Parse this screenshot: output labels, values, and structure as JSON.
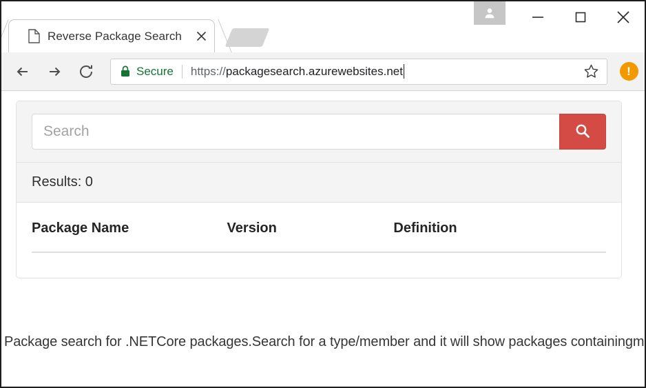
{
  "window": {
    "profile_icon": "person-icon",
    "minimize_label": "–",
    "maximize_label": "□",
    "close_label": "✕"
  },
  "tab": {
    "favicon": "document-icon",
    "title": "Reverse Package Search",
    "close_label": "✕",
    "newtab_name": "new-tab-button"
  },
  "toolbar": {
    "back_icon": "back-arrow-icon",
    "forward_icon": "forward-arrow-icon",
    "reload_icon": "reload-icon",
    "lock_icon": "lock-icon",
    "secure_label": "Secure",
    "url_scheme": "https://",
    "url_host": "packagesearch.azurewebsites.net",
    "star_icon": "bookmark-star-icon",
    "menu_icon": "chrome-menu-update-icon",
    "menu_badge": "!"
  },
  "page": {
    "search": {
      "placeholder": "Search",
      "value": "",
      "button_icon": "magnifier-icon",
      "button_color": "#d44a45"
    },
    "results": {
      "label": "Results: 0"
    },
    "table": {
      "headers": [
        "Package Name",
        "Version",
        "Definition"
      ],
      "rows": []
    },
    "caption": "Package search for .NETCore packages.Search for a type/member and it will show packages containingmatch"
  }
}
